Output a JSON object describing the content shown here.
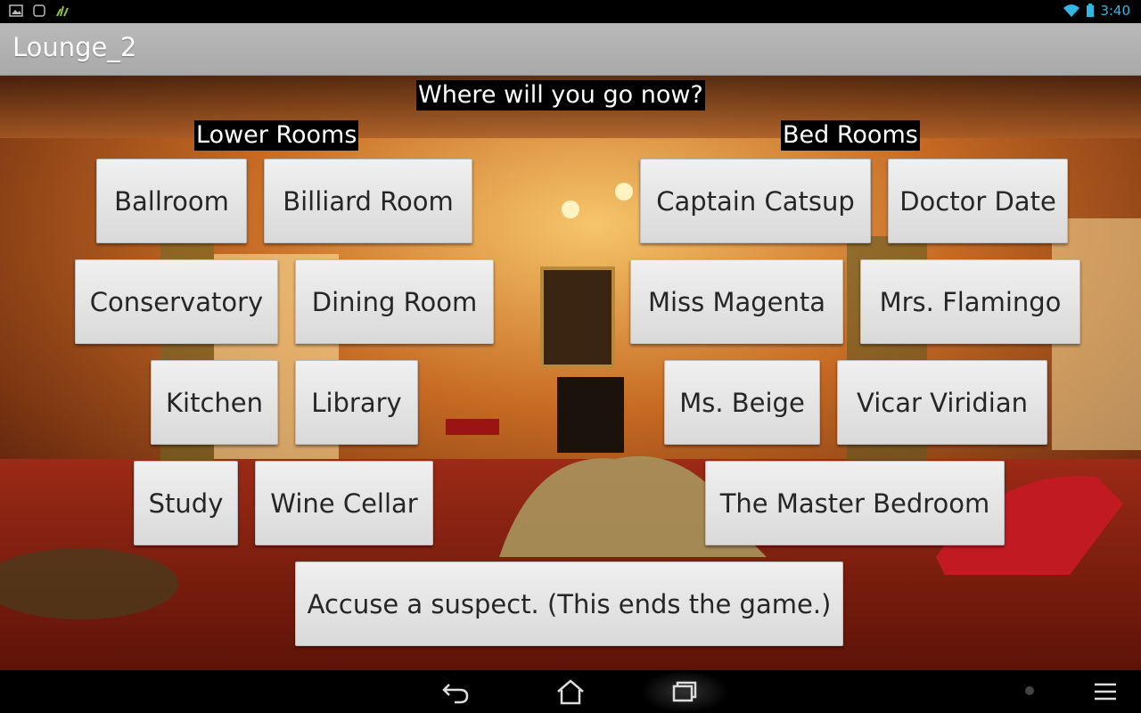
{
  "app": {
    "title": "Lounge_2"
  },
  "status": {
    "time": "3:40"
  },
  "prompt": "Where will you go now?",
  "lower": {
    "heading": "Lower Rooms",
    "rooms": [
      "Ballroom",
      "Billiard Room",
      "Conservatory",
      "Dining Room",
      "Kitchen",
      "Library",
      "Study",
      "Wine Cellar"
    ]
  },
  "bed": {
    "heading": "Bed Rooms",
    "rooms": [
      "Captain Catsup",
      "Doctor Date",
      "Miss Magenta",
      "Mrs. Flamingo",
      "Ms. Beige",
      "Vicar Viridian",
      "The Master Bedroom"
    ]
  },
  "accuse_label": "Accuse a suspect. (This ends the game.)",
  "icons": {
    "status_left": [
      "image-icon",
      "square-icon",
      "leaf-icon"
    ],
    "status_right": [
      "wifi-icon",
      "battery-icon"
    ],
    "nav": [
      "back-icon",
      "home-icon",
      "recents-icon",
      "menu-icon"
    ]
  },
  "colors": {
    "time": "#33b5e5",
    "actionbar": "#b0b0b0",
    "button": "#e6e6e6"
  }
}
